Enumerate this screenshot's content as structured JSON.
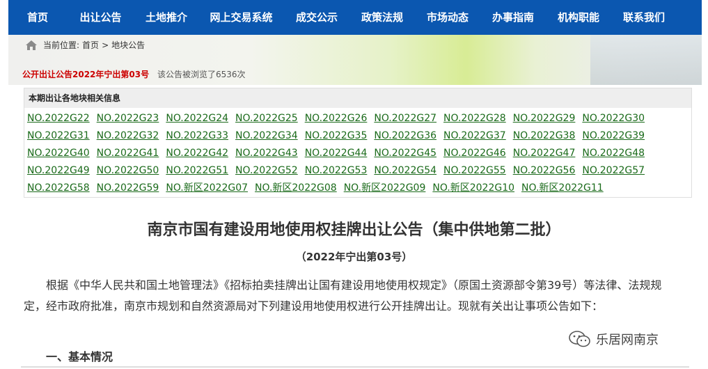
{
  "nav": {
    "items": [
      "首页",
      "出让公告",
      "土地推介",
      "网上交易系统",
      "成交公示",
      "政策法规",
      "市场动态",
      "办事指南",
      "机构职能",
      "联系我们"
    ]
  },
  "breadcrumb": {
    "label": "当前位置:",
    "home": "首页",
    "sep": ">",
    "current": "地块公告"
  },
  "notice": {
    "title": "公开出让公告2022年宁出第03号",
    "views": "该公告被浏览了6536次"
  },
  "plots": {
    "heading": "本期出让各地块相关信息",
    "items": [
      "NO.2022G22",
      "NO.2022G23",
      "NO.2022G24",
      "NO.2022G25",
      "NO.2022G26",
      "NO.2022G27",
      "NO.2022G28",
      "NO.2022G29",
      "NO.2022G30",
      "NO.2022G31",
      "NO.2022G32",
      "NO.2022G33",
      "NO.2022G34",
      "NO.2022G35",
      "NO.2022G36",
      "NO.2022G37",
      "NO.2022G38",
      "NO.2022G39",
      "NO.2022G40",
      "NO.2022G41",
      "NO.2022G42",
      "NO.2022G43",
      "NO.2022G44",
      "NO.2022G45",
      "NO.2022G46",
      "NO.2022G47",
      "NO.2022G48",
      "NO.2022G49",
      "NO.2022G50",
      "NO.2022G51",
      "NO.2022G52",
      "NO.2022G53",
      "NO.2022G54",
      "NO.2022G55",
      "NO.2022G56",
      "NO.2022G57",
      "NO.2022G58",
      "NO.2022G59",
      "NO.新区2022G07",
      "NO.新区2022G08",
      "NO.新区2022G09",
      "NO.新区2022G10",
      "NO.新区2022G11"
    ]
  },
  "document": {
    "title": "南京市国有建设用地使用权挂牌出让公告（集中供地第二批）",
    "subtitle": "（2022年宁出第03号）",
    "paragraph": "根据《中华人民共和国土地管理法》《招标拍卖挂牌出让国有建设用地使用权规定》（原国土资源部令第39号）等法律、法规规定，经市政府批准，南京市规划和自然资源局对下列建设用地使用权进行公开挂牌出让。现就有关出让事项公告如下：",
    "section1": "一、基本情况"
  },
  "watermark": {
    "text": "乐居网南京",
    "icon": "wechat-icon"
  },
  "colors": {
    "nav": "#0b57b0",
    "link": "#1a6a1a",
    "notice": "#cc0000"
  }
}
